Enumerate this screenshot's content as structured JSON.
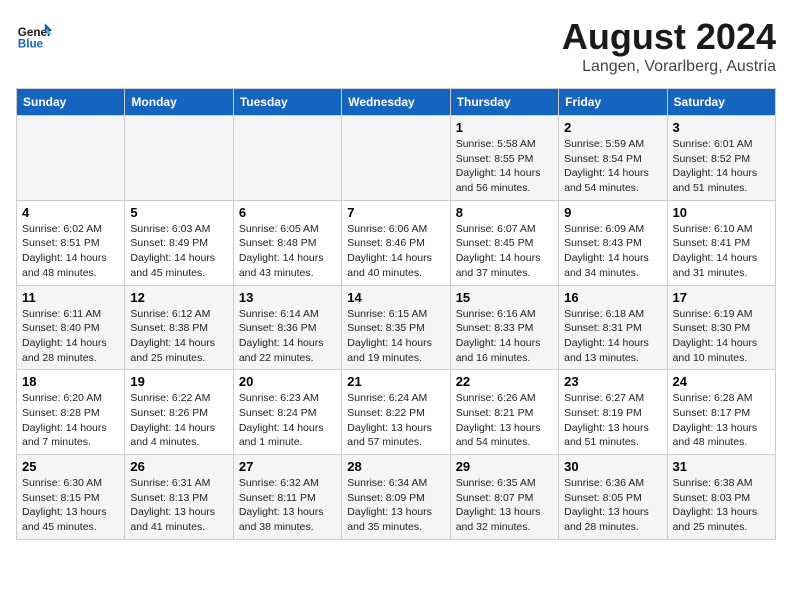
{
  "header": {
    "logo_line1": "General",
    "logo_line2": "Blue",
    "main_title": "August 2024",
    "subtitle": "Langen, Vorarlberg, Austria"
  },
  "days_of_week": [
    "Sunday",
    "Monday",
    "Tuesday",
    "Wednesday",
    "Thursday",
    "Friday",
    "Saturday"
  ],
  "weeks": [
    [
      {
        "num": "",
        "info": ""
      },
      {
        "num": "",
        "info": ""
      },
      {
        "num": "",
        "info": ""
      },
      {
        "num": "",
        "info": ""
      },
      {
        "num": "1",
        "info": "Sunrise: 5:58 AM\nSunset: 8:55 PM\nDaylight: 14 hours and 56 minutes."
      },
      {
        "num": "2",
        "info": "Sunrise: 5:59 AM\nSunset: 8:54 PM\nDaylight: 14 hours and 54 minutes."
      },
      {
        "num": "3",
        "info": "Sunrise: 6:01 AM\nSunset: 8:52 PM\nDaylight: 14 hours and 51 minutes."
      }
    ],
    [
      {
        "num": "4",
        "info": "Sunrise: 6:02 AM\nSunset: 8:51 PM\nDaylight: 14 hours and 48 minutes."
      },
      {
        "num": "5",
        "info": "Sunrise: 6:03 AM\nSunset: 8:49 PM\nDaylight: 14 hours and 45 minutes."
      },
      {
        "num": "6",
        "info": "Sunrise: 6:05 AM\nSunset: 8:48 PM\nDaylight: 14 hours and 43 minutes."
      },
      {
        "num": "7",
        "info": "Sunrise: 6:06 AM\nSunset: 8:46 PM\nDaylight: 14 hours and 40 minutes."
      },
      {
        "num": "8",
        "info": "Sunrise: 6:07 AM\nSunset: 8:45 PM\nDaylight: 14 hours and 37 minutes."
      },
      {
        "num": "9",
        "info": "Sunrise: 6:09 AM\nSunset: 8:43 PM\nDaylight: 14 hours and 34 minutes."
      },
      {
        "num": "10",
        "info": "Sunrise: 6:10 AM\nSunset: 8:41 PM\nDaylight: 14 hours and 31 minutes."
      }
    ],
    [
      {
        "num": "11",
        "info": "Sunrise: 6:11 AM\nSunset: 8:40 PM\nDaylight: 14 hours and 28 minutes."
      },
      {
        "num": "12",
        "info": "Sunrise: 6:12 AM\nSunset: 8:38 PM\nDaylight: 14 hours and 25 minutes."
      },
      {
        "num": "13",
        "info": "Sunrise: 6:14 AM\nSunset: 8:36 PM\nDaylight: 14 hours and 22 minutes."
      },
      {
        "num": "14",
        "info": "Sunrise: 6:15 AM\nSunset: 8:35 PM\nDaylight: 14 hours and 19 minutes."
      },
      {
        "num": "15",
        "info": "Sunrise: 6:16 AM\nSunset: 8:33 PM\nDaylight: 14 hours and 16 minutes."
      },
      {
        "num": "16",
        "info": "Sunrise: 6:18 AM\nSunset: 8:31 PM\nDaylight: 14 hours and 13 minutes."
      },
      {
        "num": "17",
        "info": "Sunrise: 6:19 AM\nSunset: 8:30 PM\nDaylight: 14 hours and 10 minutes."
      }
    ],
    [
      {
        "num": "18",
        "info": "Sunrise: 6:20 AM\nSunset: 8:28 PM\nDaylight: 14 hours and 7 minutes."
      },
      {
        "num": "19",
        "info": "Sunrise: 6:22 AM\nSunset: 8:26 PM\nDaylight: 14 hours and 4 minutes."
      },
      {
        "num": "20",
        "info": "Sunrise: 6:23 AM\nSunset: 8:24 PM\nDaylight: 14 hours and 1 minute."
      },
      {
        "num": "21",
        "info": "Sunrise: 6:24 AM\nSunset: 8:22 PM\nDaylight: 13 hours and 57 minutes."
      },
      {
        "num": "22",
        "info": "Sunrise: 6:26 AM\nSunset: 8:21 PM\nDaylight: 13 hours and 54 minutes."
      },
      {
        "num": "23",
        "info": "Sunrise: 6:27 AM\nSunset: 8:19 PM\nDaylight: 13 hours and 51 minutes."
      },
      {
        "num": "24",
        "info": "Sunrise: 6:28 AM\nSunset: 8:17 PM\nDaylight: 13 hours and 48 minutes."
      }
    ],
    [
      {
        "num": "25",
        "info": "Sunrise: 6:30 AM\nSunset: 8:15 PM\nDaylight: 13 hours and 45 minutes."
      },
      {
        "num": "26",
        "info": "Sunrise: 6:31 AM\nSunset: 8:13 PM\nDaylight: 13 hours and 41 minutes."
      },
      {
        "num": "27",
        "info": "Sunrise: 6:32 AM\nSunset: 8:11 PM\nDaylight: 13 hours and 38 minutes."
      },
      {
        "num": "28",
        "info": "Sunrise: 6:34 AM\nSunset: 8:09 PM\nDaylight: 13 hours and 35 minutes."
      },
      {
        "num": "29",
        "info": "Sunrise: 6:35 AM\nSunset: 8:07 PM\nDaylight: 13 hours and 32 minutes."
      },
      {
        "num": "30",
        "info": "Sunrise: 6:36 AM\nSunset: 8:05 PM\nDaylight: 13 hours and 28 minutes."
      },
      {
        "num": "31",
        "info": "Sunrise: 6:38 AM\nSunset: 8:03 PM\nDaylight: 13 hours and 25 minutes."
      }
    ]
  ]
}
